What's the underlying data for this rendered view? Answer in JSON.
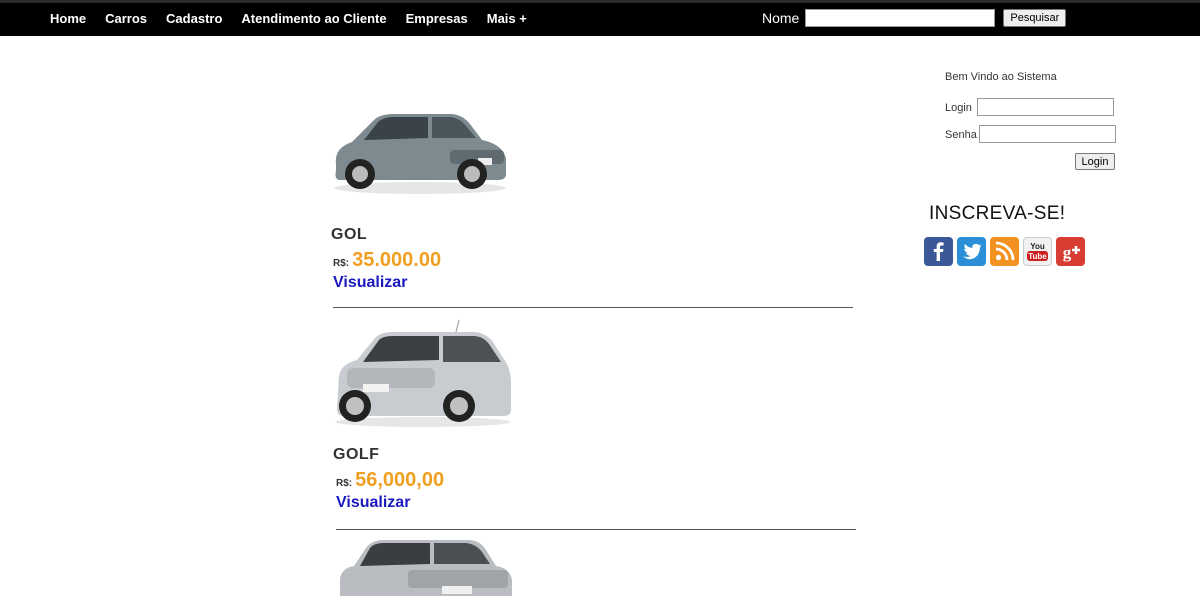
{
  "nav": {
    "items": [
      "Home",
      "Carros",
      "Cadastro",
      "Atendimento ao Cliente",
      "Empresas",
      "Mais +"
    ]
  },
  "search": {
    "label": "Nome",
    "value": "",
    "button": "Pesquisar"
  },
  "cars": [
    {
      "name": "GOL",
      "currency": "R$:",
      "price": "35.000.00",
      "action": "Visualizar"
    },
    {
      "name": "GOLF",
      "currency": "R$:",
      "price": "56,000,00",
      "action": "Visualizar"
    },
    {
      "name": "",
      "currency": "",
      "price": "",
      "action": ""
    }
  ],
  "sidebar": {
    "welcome": "Bem Vindo ao Sistema",
    "login_label": "Login",
    "password_label": "Senha",
    "login_button": "Login",
    "subscribe": "INSCREVA-SE!",
    "social_icons": [
      "facebook-icon",
      "twitter-icon",
      "rss-icon",
      "youtube-icon",
      "google-plus-icon"
    ]
  },
  "colors": {
    "topbar": "#000000",
    "price": "#f0a020",
    "link": "#1a1ac0"
  }
}
